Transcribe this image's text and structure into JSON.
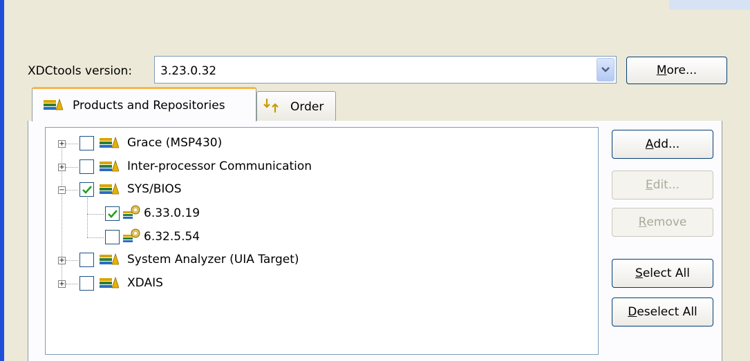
{
  "xdctools": {
    "label": "XDCtools version:",
    "value": "3.23.0.32",
    "more_prefix": "",
    "more_ul": "M",
    "more_rest": "ore..."
  },
  "tabs": [
    {
      "label": "Products and Repositories",
      "active": true
    },
    {
      "label": "Order",
      "active": false
    }
  ],
  "tree": {
    "items": [
      {
        "label": "Grace (MSP430)",
        "checked": false,
        "expanded": false
      },
      {
        "label": "Inter-processor Communication",
        "checked": false,
        "expanded": false
      },
      {
        "label": "SYS/BIOS",
        "checked": true,
        "expanded": true
      },
      {
        "label": "6.33.0.19",
        "checked": true
      },
      {
        "label": "6.32.5.54",
        "checked": false
      },
      {
        "label": "System Analyzer (UIA Target)",
        "checked": false,
        "expanded": false
      },
      {
        "label": "XDAIS",
        "checked": false,
        "expanded": false
      }
    ]
  },
  "buttons": {
    "add": {
      "ul": "A",
      "rest": "dd..."
    },
    "edit": {
      "ul": "E",
      "rest": "dit..."
    },
    "remove": {
      "ul": "R",
      "rest": "emove"
    },
    "select_all": {
      "ul": "S",
      "rest": "elect All"
    },
    "deselect_all": {
      "ul": "D",
      "rest": "eselect All"
    }
  },
  "colors": {
    "accent": "#1f4fd8",
    "tab_highlight": "#f7b64a",
    "check": "#21a121"
  }
}
